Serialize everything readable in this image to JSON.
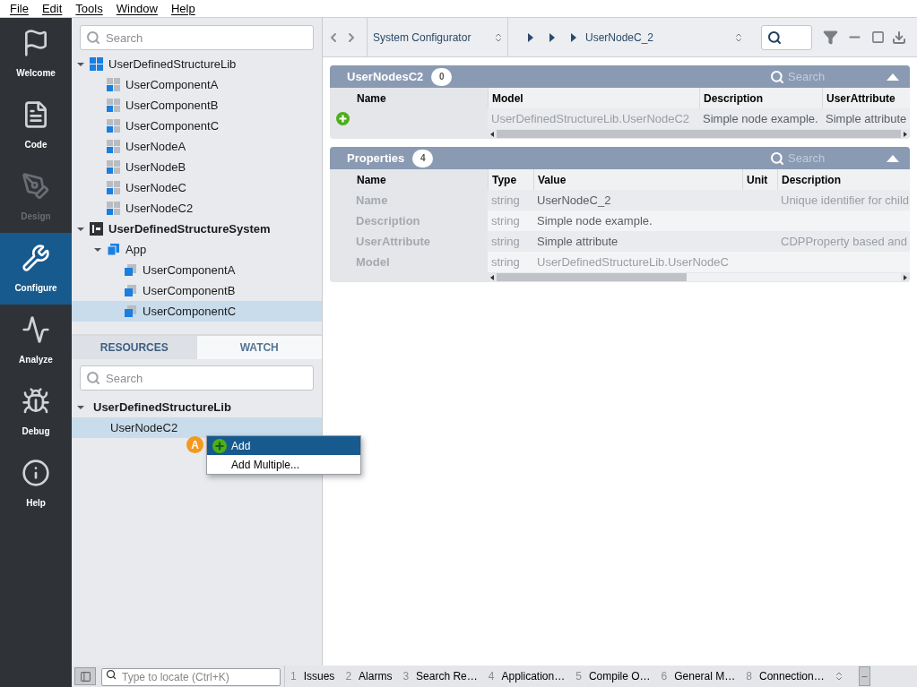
{
  "menu": [
    "File",
    "Edit",
    "Tools",
    "Window",
    "Help"
  ],
  "nav": [
    {
      "label": "Welcome",
      "kind": "flag",
      "selected": false,
      "disabled": false
    },
    {
      "label": "Code",
      "kind": "code",
      "selected": false,
      "disabled": false
    },
    {
      "label": "Design",
      "kind": "design",
      "selected": false,
      "disabled": true
    },
    {
      "label": "Configure",
      "kind": "configure",
      "selected": true,
      "disabled": false
    },
    {
      "label": "Analyze",
      "kind": "analyze",
      "selected": false,
      "disabled": false
    },
    {
      "label": "Debug",
      "kind": "debug",
      "selected": false,
      "disabled": false
    },
    {
      "label": "Help",
      "kind": "help",
      "selected": false,
      "disabled": false
    }
  ],
  "project_tree": {
    "search": {
      "placeholder": "Search"
    },
    "items": [
      {
        "label": "UserDefinedStructureLib",
        "kind": "library",
        "bold": false,
        "expanded": true,
        "selected": false,
        "children": [
          {
            "label": "UserComponentA",
            "kind": "type",
            "selected": false
          },
          {
            "label": "UserComponentB",
            "kind": "type",
            "selected": false
          },
          {
            "label": "UserComponentC",
            "kind": "type",
            "selected": false
          },
          {
            "label": "UserNodeA",
            "kind": "type",
            "selected": false
          },
          {
            "label": "UserNodeB",
            "kind": "type",
            "selected": false
          },
          {
            "label": "UserNodeC",
            "kind": "type",
            "selected": false
          },
          {
            "label": "UserNodeC2",
            "kind": "type",
            "selected": false
          }
        ]
      },
      {
        "label": "UserDefinedStructureSystem",
        "kind": "system",
        "bold": true,
        "expanded": true,
        "selected": false,
        "children": [
          {
            "label": "App",
            "kind": "app",
            "expanded": true,
            "selected": false,
            "children": [
              {
                "label": "UserComponentA",
                "kind": "instance",
                "selected": false
              },
              {
                "label": "UserComponentB",
                "kind": "instance",
                "selected": false
              },
              {
                "label": "UserComponentC",
                "kind": "instance",
                "selected": true
              }
            ]
          }
        ]
      }
    ]
  },
  "bottom_tabs": [
    {
      "label": "RESOURCES",
      "selected": true
    },
    {
      "label": "WATCH",
      "selected": false
    }
  ],
  "resources": {
    "search": {
      "placeholder": "Search"
    },
    "items": [
      {
        "label": "UserDefinedStructureLib",
        "bold": true,
        "expanded": true,
        "selected": false,
        "children": [
          {
            "label": "UserNodeC2",
            "bold": false,
            "selected": true
          }
        ]
      }
    ]
  },
  "context_menu": {
    "badge": "A",
    "items": [
      {
        "label": "Add",
        "selected": true,
        "kind": "add"
      },
      {
        "label": "Add Multiple...",
        "selected": false,
        "kind": "plain"
      }
    ]
  },
  "toolbar": {
    "view": "System Configurator",
    "breadcrumb": "UserNodeC_2"
  },
  "sections": [
    {
      "title": "UserNodesC2",
      "count": "0",
      "search_placeholder": "Search",
      "kind": "nodes",
      "columns": [
        "Name",
        "Model",
        "Description",
        "UserAttribute"
      ],
      "rows": [
        {
          "cells": [
            "",
            "UserDefinedStructureLib.UserNodeC2",
            "Simple node example.",
            "Simple attribute"
          ],
          "add": true,
          "readonly": false
        }
      ]
    },
    {
      "title": "Properties",
      "count": "4",
      "search_placeholder": "Search",
      "kind": "properties",
      "columns": [
        "Name",
        "Type",
        "Value",
        "Unit",
        "Description"
      ],
      "rows": [
        {
          "cells": [
            "Name",
            "string",
            "UserNodeC_2",
            "",
            "Unique identifier for child"
          ],
          "add": false,
          "readonly": false
        },
        {
          "cells": [
            "Description",
            "string",
            "Simple node example.",
            "",
            ""
          ],
          "add": false,
          "readonly": false
        },
        {
          "cells": [
            "UserAttribute",
            "string",
            "Simple attribute",
            "",
            "CDPProperty based and"
          ],
          "add": false,
          "readonly": false
        },
        {
          "cells": [
            "Model",
            "string",
            "UserDefinedStructureLib.UserNodeC",
            "",
            ""
          ],
          "add": false,
          "readonly": true
        }
      ]
    }
  ],
  "status_bar": {
    "locate_placeholder": "Type to locate (Ctrl+K)",
    "tabs": [
      {
        "number": "1",
        "label": "Issues"
      },
      {
        "number": "2",
        "label": "Alarms"
      },
      {
        "number": "3",
        "label": "Search Re…"
      },
      {
        "number": "4",
        "label": "Application…"
      },
      {
        "number": "5",
        "label": "Compile O…"
      },
      {
        "number": "6",
        "label": "General M…"
      },
      {
        "number": "8",
        "label": "Connection…"
      }
    ]
  }
}
